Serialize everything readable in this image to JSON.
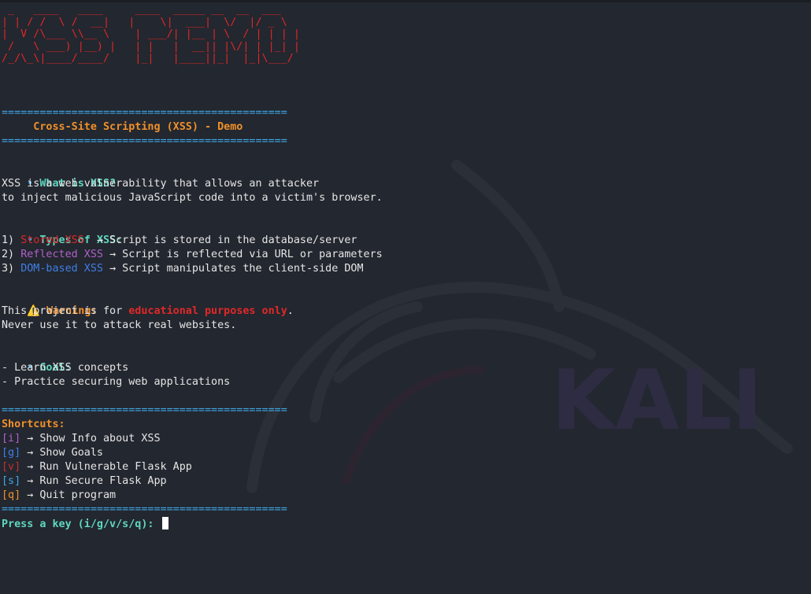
{
  "banner": {
    "ascii_art": " _   ____   ____     ____  _____ __  __  ___\n| | / /  \\ /  __|   |    \\|  ___|  \\/  |/ _ \\\n|  V /\\___ \\\\__ \\    | ___/| |__ | \\  / | | | |\n /   \\ ___) |__) |   | |   |  __|| |\\/| | |_| |\n/_/\\_\\|____/____/    |_|   |____||_|  |_|\\___/"
  },
  "separator": "=============================================",
  "title": "     Cross-Site Scripting (XSS) - Demo",
  "what": {
    "bullet": "•",
    "heading": "What is XSS?",
    "line1": "XSS is a web vulnerability that allows an attacker",
    "line2": "to inject malicious JavaScript code into a victim's browser."
  },
  "types": {
    "bullet": "•",
    "heading": "Types of XSS:",
    "items": [
      {
        "num": "1) ",
        "name": "Stored XSS",
        "gap": "  ",
        "desc": "→ Script is stored in the database/server"
      },
      {
        "num": "2) ",
        "name": "Reflected XSS",
        "gap": " ",
        "desc": "→ Script is reflected via URL or parameters"
      },
      {
        "num": "3) ",
        "name": "DOM-based XSS",
        "gap": " ",
        "desc": "→ Script manipulates the client-side DOM"
      }
    ]
  },
  "warning": {
    "icon": "⚠️",
    "heading": "Warning:",
    "line1_pre": "This project is for ",
    "line1_highlight": "educational purposes only",
    "line1_post": ".",
    "line2": "Never use it to attack real websites."
  },
  "goal": {
    "bullet": "•",
    "heading": "Goal:",
    "items": [
      "- Learn XSS concepts",
      "- Practice securing web applications"
    ]
  },
  "shortcuts": {
    "heading": "Shortcuts:",
    "items": [
      {
        "key": "[i]",
        "desc": " → Show Info about XSS"
      },
      {
        "key": "[g]",
        "desc": " → Show Goals"
      },
      {
        "key": "[v]",
        "desc": " → Run Vulnerable Flask App"
      },
      {
        "key": "[s]",
        "desc": " → Run Secure Flask App"
      },
      {
        "key": "[q]",
        "desc": " → Quit program"
      }
    ]
  },
  "prompt": "Press a key (i/g/v/s/q): ",
  "watermark": {
    "text": "KALI",
    "icon": "kali-dragon-watermark"
  },
  "colors": {
    "background": "#23272f",
    "separator": "#3fa8e8",
    "title": "#f0902a",
    "heading": "#5fd7c0",
    "stored": "#e02828",
    "reflected": "#b060c8",
    "dom": "#3f7fe8"
  }
}
